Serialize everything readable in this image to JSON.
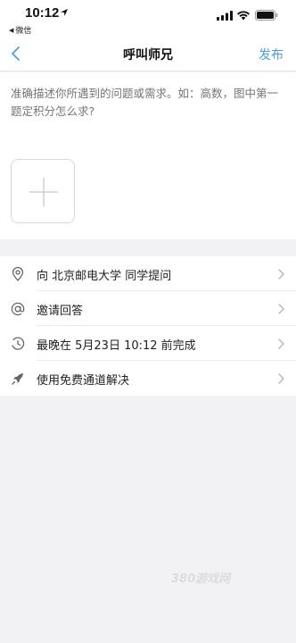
{
  "status_bar": {
    "time": "10:12",
    "back_app": "微信"
  },
  "nav": {
    "title": "呼叫师兄",
    "action": "发布"
  },
  "compose": {
    "placeholder": "准确描述你所遇到的问题或需求。如：高数，图中第一题定积分怎么求?"
  },
  "options": [
    {
      "icon": "location-pin-icon",
      "label": "向 北京邮电大学 同学提问"
    },
    {
      "icon": "at-sign-icon",
      "label": "邀请回答"
    },
    {
      "icon": "clock-icon",
      "label": "最晚在 5月23日 10:12 前完成"
    },
    {
      "icon": "rocket-icon",
      "label": "使用免费通道解决"
    }
  ],
  "watermark": "380游戏网",
  "colors": {
    "accent": "#4a9fe0",
    "background": "#f2f2f4",
    "placeholder": "#b3b3b3"
  }
}
